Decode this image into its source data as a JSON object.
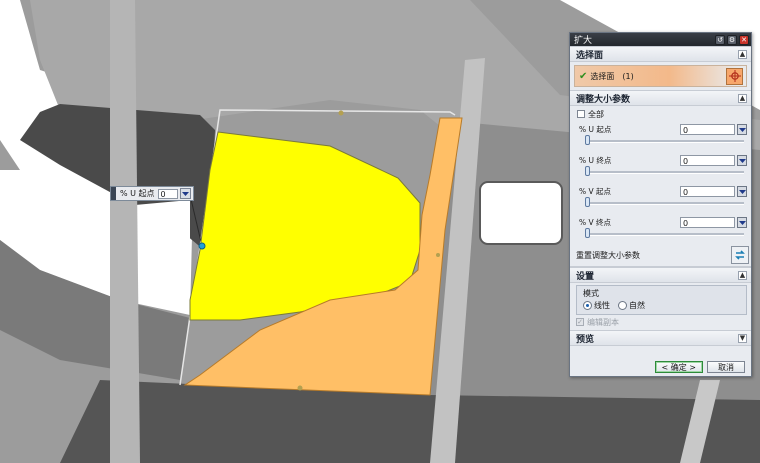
{
  "dialog": {
    "title": "扩大",
    "select_face": {
      "header": "选择面",
      "label": "选择面",
      "count": "(1)"
    },
    "resize_params": {
      "header": "调整大小参数",
      "all_label": "全部",
      "params": [
        {
          "label": "% U 起点",
          "value": "0"
        },
        {
          "label": "% U 终点",
          "value": "0"
        },
        {
          "label": "% V 起点",
          "value": "0"
        },
        {
          "label": "% V 终点",
          "value": "0"
        }
      ],
      "reset_label": "重置调整大小参数"
    },
    "settings": {
      "header": "设置",
      "mode_title": "模式",
      "linear_label": "线性",
      "natural_label": "自然",
      "selected_mode": "线性",
      "disabled_option": "编辑副本"
    },
    "preview": {
      "header": "预览"
    },
    "ok_label": "< 确定 >",
    "cancel_label": "取消"
  },
  "handle_input": {
    "label": "% U 起点",
    "value": "0"
  },
  "colors": {
    "face_yellow": "#ffff00",
    "face_orange": "#ffbf66",
    "accent_orange": "#f7a76b",
    "model_gray": "#9a9a9a"
  }
}
